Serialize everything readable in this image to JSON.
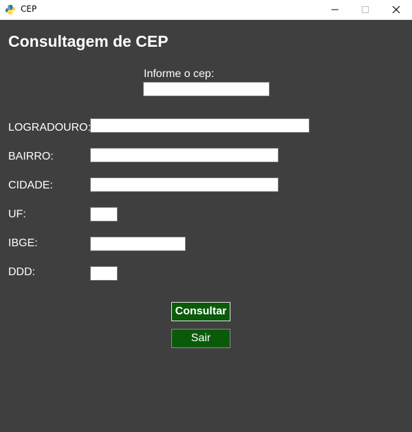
{
  "window": {
    "title": "CEP",
    "app_icon": "python-icon",
    "controls": [
      "minimize-icon",
      "maximize-icon",
      "close-icon"
    ]
  },
  "form": {
    "heading": "Consultagem de CEP",
    "cep_label": "Informe o cep:",
    "cep_value": "",
    "fields": {
      "logradouro": {
        "label": "LOGRADOURO:",
        "value": ""
      },
      "bairro": {
        "label": "BAIRRO:",
        "value": ""
      },
      "cidade": {
        "label": "CIDADE:",
        "value": ""
      },
      "uf": {
        "label": "UF:",
        "value": ""
      },
      "ibge": {
        "label": "IBGE:",
        "value": ""
      },
      "ddd": {
        "label": "DDD:",
        "value": ""
      }
    },
    "buttons": {
      "consultar": "Consultar",
      "sair": "Sair"
    }
  },
  "colors": {
    "background": "#3f3f3f",
    "button_bg": "#0a5a0a",
    "text": "#ffffff"
  }
}
